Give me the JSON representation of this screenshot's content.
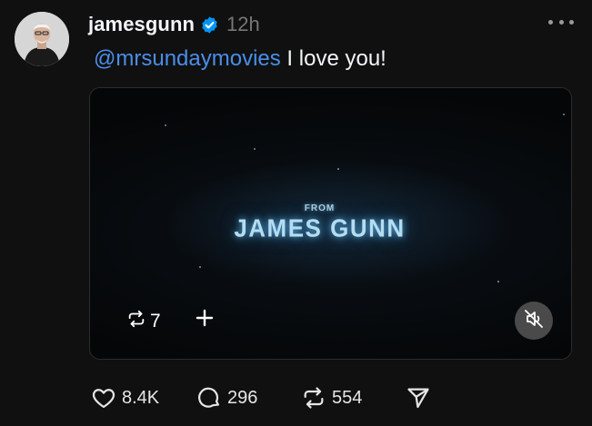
{
  "post": {
    "username": "jamesgunn",
    "verified_icon": "verified-badge-icon",
    "timestamp": "12h",
    "more_icon": "more-options-icon",
    "caption": {
      "mention": "@mrsundaymovies",
      "text": " I love you!"
    },
    "video": {
      "overlay_from": "FROM",
      "overlay_title": "JAMES GUNN",
      "repost_count": "7",
      "repost_icon": "repost-icon",
      "add_icon": "plus-icon",
      "mute_icon": "muted-speaker-icon"
    },
    "actions": {
      "likes": "8.4K",
      "replies": "296",
      "reposts": "554",
      "like_icon": "heart-icon",
      "reply_icon": "comment-icon",
      "repost_icon": "repost-icon",
      "share_icon": "send-icon"
    }
  },
  "colors": {
    "background": "#101010",
    "text": "#f3f5f7",
    "muted": "#777777",
    "mention": "#4a8eea",
    "verified": "#0095f6",
    "title_glow": "#b6dcef"
  }
}
